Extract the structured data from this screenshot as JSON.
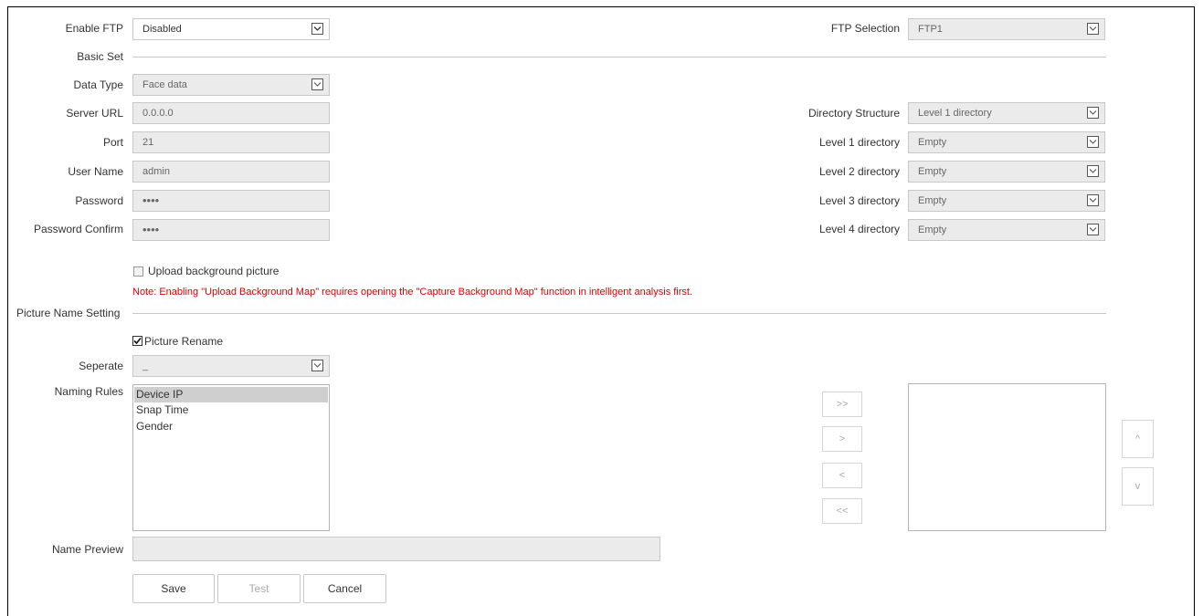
{
  "general": {
    "enable_ftp_label": "Enable FTP",
    "enable_ftp_value": "Disabled",
    "ftp_selection_label": "FTP Selection",
    "ftp_selection_value": "FTP1"
  },
  "basic_set": {
    "title": "Basic Set",
    "data_type_label": "Data Type",
    "data_type_value": "Face data",
    "server_url_label": "Server URL",
    "server_url_value": "0.0.0.0",
    "port_label": "Port",
    "port_value": "21",
    "user_name_label": "User Name",
    "user_name_value": "admin",
    "password_label": "Password",
    "password_value": "••••",
    "password_confirm_label": "Password Confirm",
    "password_confirm_value": "••••",
    "directory_structure_label": "Directory Structure",
    "directory_structure_value": "Level 1 directory",
    "level1_label": "Level 1 directory",
    "level1_value": "Empty",
    "level2_label": "Level 2 directory",
    "level2_value": "Empty",
    "level3_label": "Level 3 directory",
    "level3_value": "Empty",
    "level4_label": "Level 4 directory",
    "level4_value": "Empty",
    "upload_bg_label": "Upload background picture",
    "upload_bg_checked": false,
    "note": "Note: Enabling \"Upload Background Map\" requires opening the \"Capture Background Map\" function in intelligent analysis first."
  },
  "picture_name": {
    "title": "Picture Name Setting",
    "rename_label": "Picture Rename",
    "rename_checked": true,
    "separate_label": "Seperate",
    "separate_value": "_",
    "naming_rules_label": "Naming Rules",
    "naming_rules": [
      "Device IP",
      "Snap Time",
      "Gender"
    ],
    "selected_rule": "Device IP",
    "move_buttons": {
      "add_all": ">>",
      "add": ">",
      "remove": "<",
      "remove_all": "<<"
    },
    "order_buttons": {
      "up": "^",
      "down": "v"
    },
    "name_preview_label": "Name Preview",
    "name_preview_value": ""
  },
  "actions": {
    "save": "Save",
    "test": "Test",
    "cancel": "Cancel"
  },
  "colors": {
    "note_red": "#e00000",
    "disabled_field": "#ebebeb",
    "selected_item": "#cfcfcf"
  }
}
